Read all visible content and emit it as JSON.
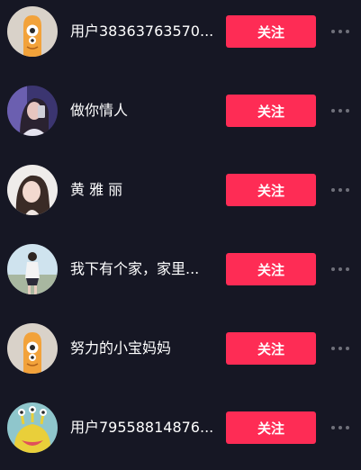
{
  "follow_list": {
    "items": [
      {
        "avatar_icon": "orange-mascot-avatar",
        "name": "用户38363763570...",
        "action": "关注"
      },
      {
        "avatar_icon": "girl-photo-avatar",
        "name": "做你情人",
        "action": "关注"
      },
      {
        "avatar_icon": "girl-photo-avatar",
        "name": "黄 雅 丽",
        "action": "关注"
      },
      {
        "avatar_icon": "girl-photo-avatar",
        "name": "我下有个家，家里...",
        "action": "关注"
      },
      {
        "avatar_icon": "orange-mascot-avatar",
        "name": "努力的小宝妈妈",
        "action": "关注"
      },
      {
        "avatar_icon": "yellow-monster-avatar",
        "name": "用户79558814876...",
        "action": "关注"
      }
    ]
  },
  "colors": {
    "background": "#161724",
    "follow_button": "#fe2c55",
    "text": "#ffffff",
    "more_dots": "#6f707a"
  }
}
